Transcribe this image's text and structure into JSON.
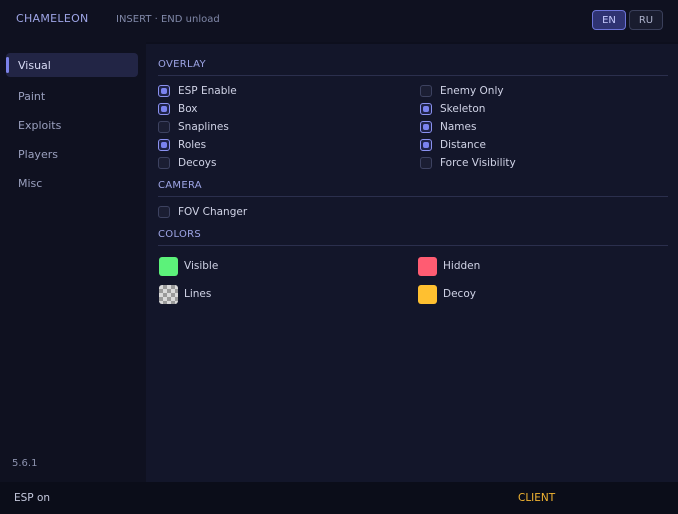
{
  "header": {
    "app_title": "CHAMELEON",
    "hint": "INSERT · END unload",
    "languages": [
      {
        "label": "EN",
        "active": true
      },
      {
        "label": "RU",
        "active": false
      }
    ]
  },
  "sidebar": {
    "items": [
      {
        "label": "Visual",
        "active": true
      },
      {
        "label": "Paint",
        "active": false
      },
      {
        "label": "Exploits",
        "active": false
      },
      {
        "label": "Players",
        "active": false
      },
      {
        "label": "Misc",
        "active": false
      }
    ],
    "version": "5.6.1"
  },
  "overlay": {
    "title": "OVERLAY",
    "left": [
      {
        "label": "ESP Enable",
        "checked": true
      },
      {
        "label": "Box",
        "checked": true
      },
      {
        "label": "Snaplines",
        "checked": false
      },
      {
        "label": "Roles",
        "checked": true
      },
      {
        "label": "Decoys",
        "checked": false
      }
    ],
    "right": [
      {
        "label": "Enemy Only",
        "checked": false
      },
      {
        "label": "Skeleton",
        "checked": true
      },
      {
        "label": "Names",
        "checked": true
      },
      {
        "label": "Distance",
        "checked": true
      },
      {
        "label": "Force Visibility",
        "checked": false
      }
    ]
  },
  "camera": {
    "title": "CAMERA",
    "items": [
      {
        "label": "FOV Changer",
        "checked": false
      }
    ]
  },
  "colors": {
    "title": "COLORS",
    "items": [
      {
        "label": "Visible",
        "color": "#5cf27a"
      },
      {
        "label": "Hidden",
        "color": "#ff5c72"
      },
      {
        "label": "Lines",
        "color": "checker"
      },
      {
        "label": "Decoy",
        "color": "#ffc030"
      }
    ]
  },
  "status": {
    "left": "ESP on",
    "right": "CLIENT",
    "right_color": "#f2b431"
  }
}
